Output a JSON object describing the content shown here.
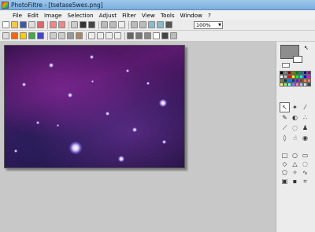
{
  "window": {
    "title": "PhotoFiltre - [tsetase5wes.png]"
  },
  "menu": [
    "File",
    "Edit",
    "Image",
    "Selection",
    "Adjust",
    "Filter",
    "View",
    "Tools",
    "Window",
    "?"
  ],
  "toolbar": {
    "zoom_value": "100%"
  },
  "panel": {
    "foreground_color": "#8d8d8d",
    "background_color": "#ffffff",
    "palette": [
      "#000000",
      "#808080",
      "#800000",
      "#808000",
      "#008000",
      "#008080",
      "#000080",
      "#800080",
      "#ffffff",
      "#c0c0c0",
      "#ff0000",
      "#ffff00",
      "#00ff00",
      "#00ffff",
      "#0000ff",
      "#ff00ff",
      "#808040",
      "#004040",
      "#0080ff",
      "#004080",
      "#8000ff",
      "#804000",
      "#ff8040",
      "#ff8080",
      "#ffff80",
      "#80ff80",
      "#80ffff",
      "#8080ff",
      "#ff80c0",
      "#c0c0ff",
      "#e0e0e0",
      "#404040"
    ],
    "tools": [
      "pointer-icon",
      "magic-wand-icon",
      "eyedropper-icon",
      "pencil-icon",
      "fill-bucket-icon",
      "spray-icon",
      "brush-icon",
      "blur-icon",
      "stamp-icon",
      "drop-icon",
      "finger-icon",
      "clone-icon"
    ],
    "shapes": [
      "rectangle-icon",
      "ellipse-icon",
      "rounded-rect-icon",
      "diamond-icon",
      "triangle-icon",
      "lasso-icon",
      "polygon-icon",
      "magic-select-icon",
      "freeform-icon",
      "selection-inverse-icon",
      "selection-square-icon",
      "crop-icon"
    ]
  }
}
